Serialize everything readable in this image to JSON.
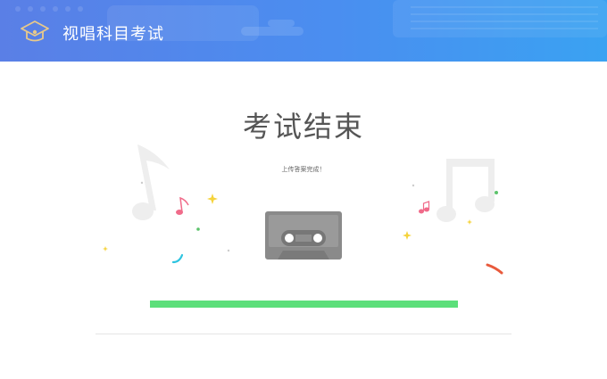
{
  "header": {
    "title": "视唱科目考试",
    "logo_icon": "graduation-cap-icon",
    "background_colors": [
      "#5a7fe6",
      "#3aa2f2"
    ]
  },
  "main": {
    "title": "考试结束",
    "status": "上传答案完成！",
    "illustration_icon": "cassette-tape-icon",
    "progress": {
      "percent": 100,
      "color": "#5cdf7a"
    }
  }
}
